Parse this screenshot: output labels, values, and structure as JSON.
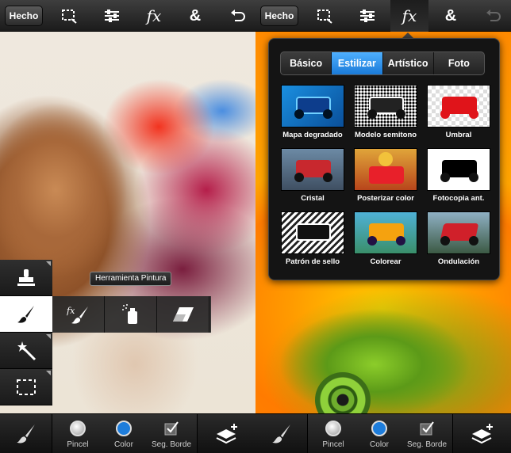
{
  "colors": {
    "accent": "#1a7ad8",
    "color_swatch": "#1e7ddb",
    "toolbar_bg": "#2b2b2b"
  },
  "left_screen": {
    "topbar": {
      "done_label": "Hecho",
      "fx_label": "fx",
      "amp_label": "&"
    },
    "tooltip": "Herramienta Pintura",
    "tools": [
      "stamp-icon",
      "brush-icon",
      "magic-wand-icon",
      "marquee-icon"
    ],
    "subtools": [
      "fx-brush-icon",
      "spray-icon",
      "eraser-icon"
    ],
    "bottombar": {
      "brush_label": "Pincel",
      "color_label": "Color",
      "edge_label": "Seg. Borde"
    }
  },
  "right_screen": {
    "topbar": {
      "done_label": "Hecho",
      "fx_label": "fx",
      "amp_label": "&"
    },
    "tabs": [
      "Básico",
      "Estilizar",
      "Artístico",
      "Foto"
    ],
    "active_tab": "Estilizar",
    "effects": [
      "Mapa degradado",
      "Modelo semitono",
      "Umbral",
      "Cristal",
      "Posterizar color",
      "Fotocopia ant.",
      "Patrón de sello",
      "Colorear",
      "Ondulación"
    ],
    "bottombar": {
      "brush_label": "Pincel",
      "color_label": "Color",
      "edge_label": "Seg. Borde"
    }
  }
}
